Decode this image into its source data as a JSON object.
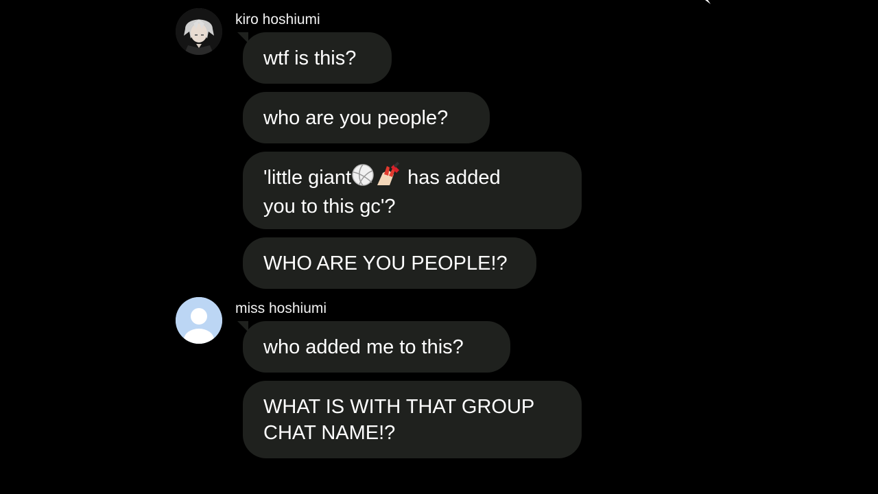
{
  "theme": {
    "background": "#000000",
    "bubble": "#1f211e",
    "text": "#ffffff",
    "default_avatar_bg": "#bcd6f4"
  },
  "chat": {
    "groups": [
      {
        "sender": "kiro hoshiumi",
        "avatar_icon": "anime-character-avatar",
        "messages": [
          "wtf is this?",
          "who are you people?",
          {
            "before": "'little giant",
            "emojis": [
              "volleyball-emoji",
              "nail-polish-emoji"
            ],
            "after": " has added\nyou to this gc'?"
          },
          "WHO ARE YOU PEOPLE!?"
        ]
      },
      {
        "sender": "miss hoshiumi",
        "avatar_icon": "default-user-avatar",
        "messages": [
          "who added me to this?",
          "WHAT IS WITH THAT GROUP\nCHAT NAME!?"
        ]
      }
    ]
  }
}
